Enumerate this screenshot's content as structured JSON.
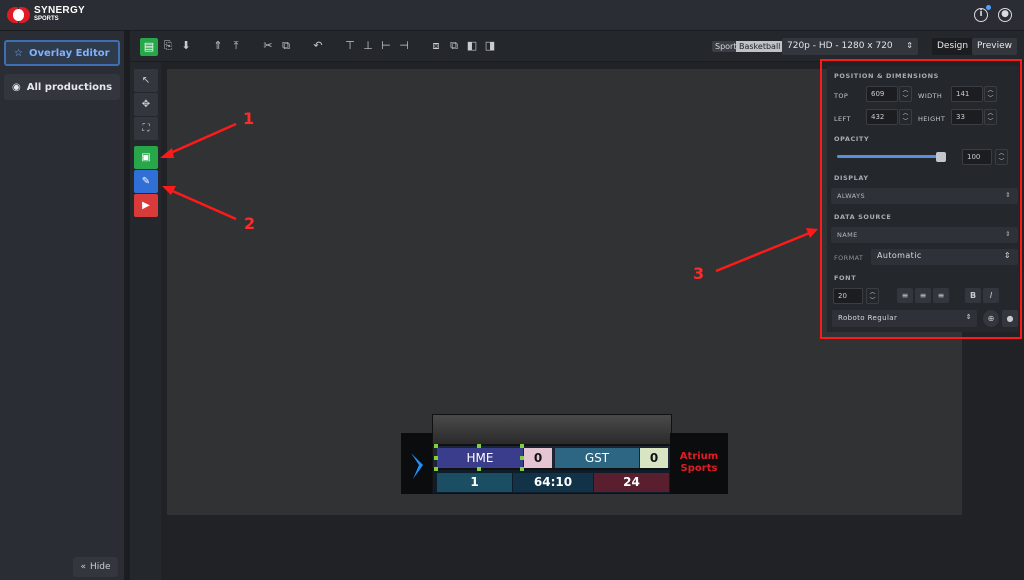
{
  "app": {
    "brand_top": "SYNERGY",
    "brand_bottom": "SPORTS"
  },
  "topbar": {
    "info_icon": "info-icon",
    "user_icon": "user-icon"
  },
  "sidebar": {
    "items": [
      {
        "label": "Overlay Editor",
        "icon": "star-icon",
        "active": true
      },
      {
        "label": "All productions",
        "icon": "camera-icon",
        "active": false
      }
    ],
    "hide_label": "Hide"
  },
  "toolbar": {
    "sport_label": "Sport",
    "sport_value": "Basketball",
    "resolution": "720p - HD - 1280 x 720",
    "modes": [
      "Design",
      "Preview"
    ],
    "active_mode": "Design"
  },
  "scoreboard": {
    "home": "HME",
    "home_score": "0",
    "guest": "GST",
    "guest_score": "0",
    "period": "1",
    "clock": "64:10",
    "shot_clock": "24",
    "sponsor": "Atrium Sports"
  },
  "properties": {
    "position_title": "POSITION & DIMENSIONS",
    "top_label": "TOP",
    "top_value": "609",
    "width_label": "WIDTH",
    "width_value": "141",
    "left_label": "LEFT",
    "left_value": "432",
    "height_label": "HEIGHT",
    "height_value": "33",
    "opacity_title": "OPACITY",
    "opacity_value": "100",
    "display_title": "DISPLAY",
    "display_value": "ALWAYS",
    "datasource_title": "DATA SOURCE",
    "datasource_value": "NAME",
    "format_label": "FORMAT",
    "format_value": "Automatic",
    "font_title": "FONT",
    "font_size": "20",
    "font_family": "Roboto Regular"
  },
  "annotations": [
    "1",
    "2",
    "3"
  ],
  "colors": {
    "accent_red": "#ff1a1a",
    "accent_green": "#27a74a",
    "accent_blue": "#2f6fd6",
    "brand_red": "#e11b22"
  }
}
